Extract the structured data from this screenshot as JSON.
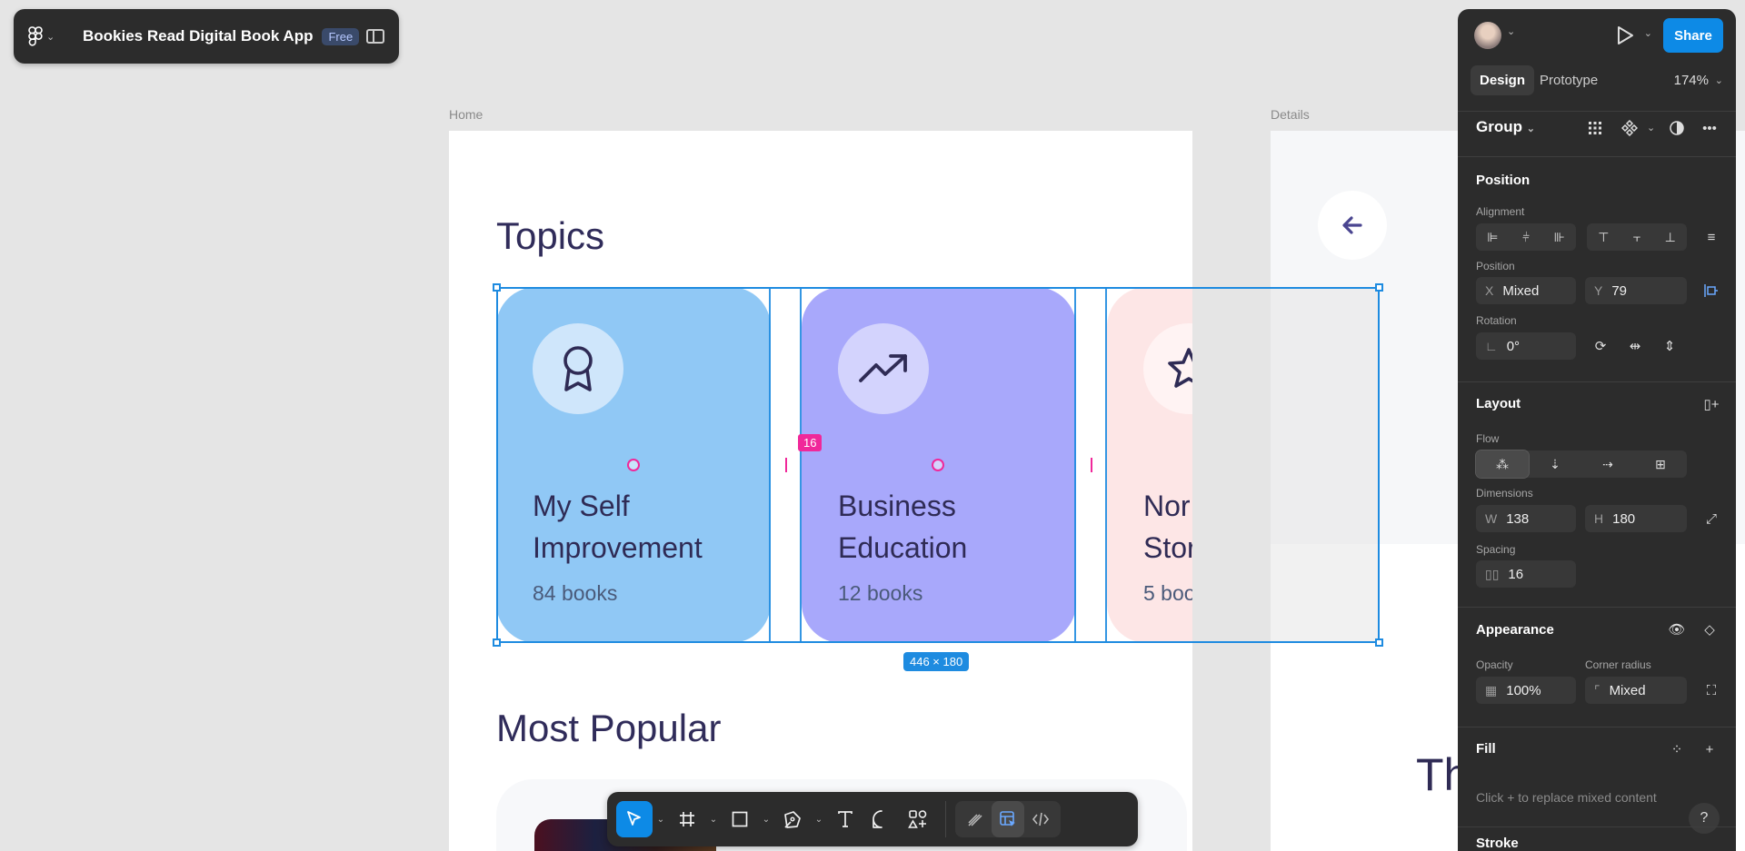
{
  "file": {
    "title": "Bookies Read Digital Book App",
    "plan_badge": "Free"
  },
  "frames": {
    "home_label": "Home",
    "details_label": "Details"
  },
  "home": {
    "topics_title": "Topics",
    "popular_title": "Most Popular",
    "topics": [
      {
        "name_line1": "My Self",
        "name_line2": "Improvement",
        "count": "84 books",
        "bg": "#90c8f5",
        "circle": "#cfe6fb",
        "icon": "award-icon"
      },
      {
        "name_line1": "Business",
        "name_line2": "Education",
        "count": "12 books",
        "bg": "#a8a8fb",
        "circle": "#d3d3fd",
        "icon": "trending-up-icon"
      },
      {
        "name_line1": "Nor",
        "name_line2": "Stor",
        "count": "5 boo",
        "bg": "#fde6e6",
        "circle": "#fff3f3",
        "icon": "star-icon"
      }
    ]
  },
  "details": {
    "heading_partial": "Th"
  },
  "selection": {
    "size": "446 × 180",
    "spacing": "16"
  },
  "panel": {
    "share": "Share",
    "tab_design": "Design",
    "tab_prototype": "Prototype",
    "zoom": "174%",
    "layer_type": "Group",
    "position_title": "Position",
    "alignment_label": "Alignment",
    "position_label": "Position",
    "x_label": "X",
    "x_value": "Mixed",
    "y_label": "Y",
    "y_value": "79",
    "rotation_label": "Rotation",
    "rotation_value": "0°",
    "layout_title": "Layout",
    "flow_label": "Flow",
    "dimensions_label": "Dimensions",
    "w_label": "W",
    "w_value": "138",
    "h_label": "H",
    "h_value": "180",
    "spacing_label": "Spacing",
    "spacing_value": "16",
    "appearance_title": "Appearance",
    "opacity_label": "Opacity",
    "opacity_value": "100%",
    "radius_label": "Corner radius",
    "radius_value": "Mixed",
    "fill_title": "Fill",
    "fill_hint": "Click + to replace mixed content",
    "stroke_title": "Stroke",
    "help": "?"
  },
  "colors": {
    "accent": "#0d8ae6",
    "selection": "#1e8be0",
    "spacing": "#f0289a",
    "heading": "#302c5a"
  }
}
